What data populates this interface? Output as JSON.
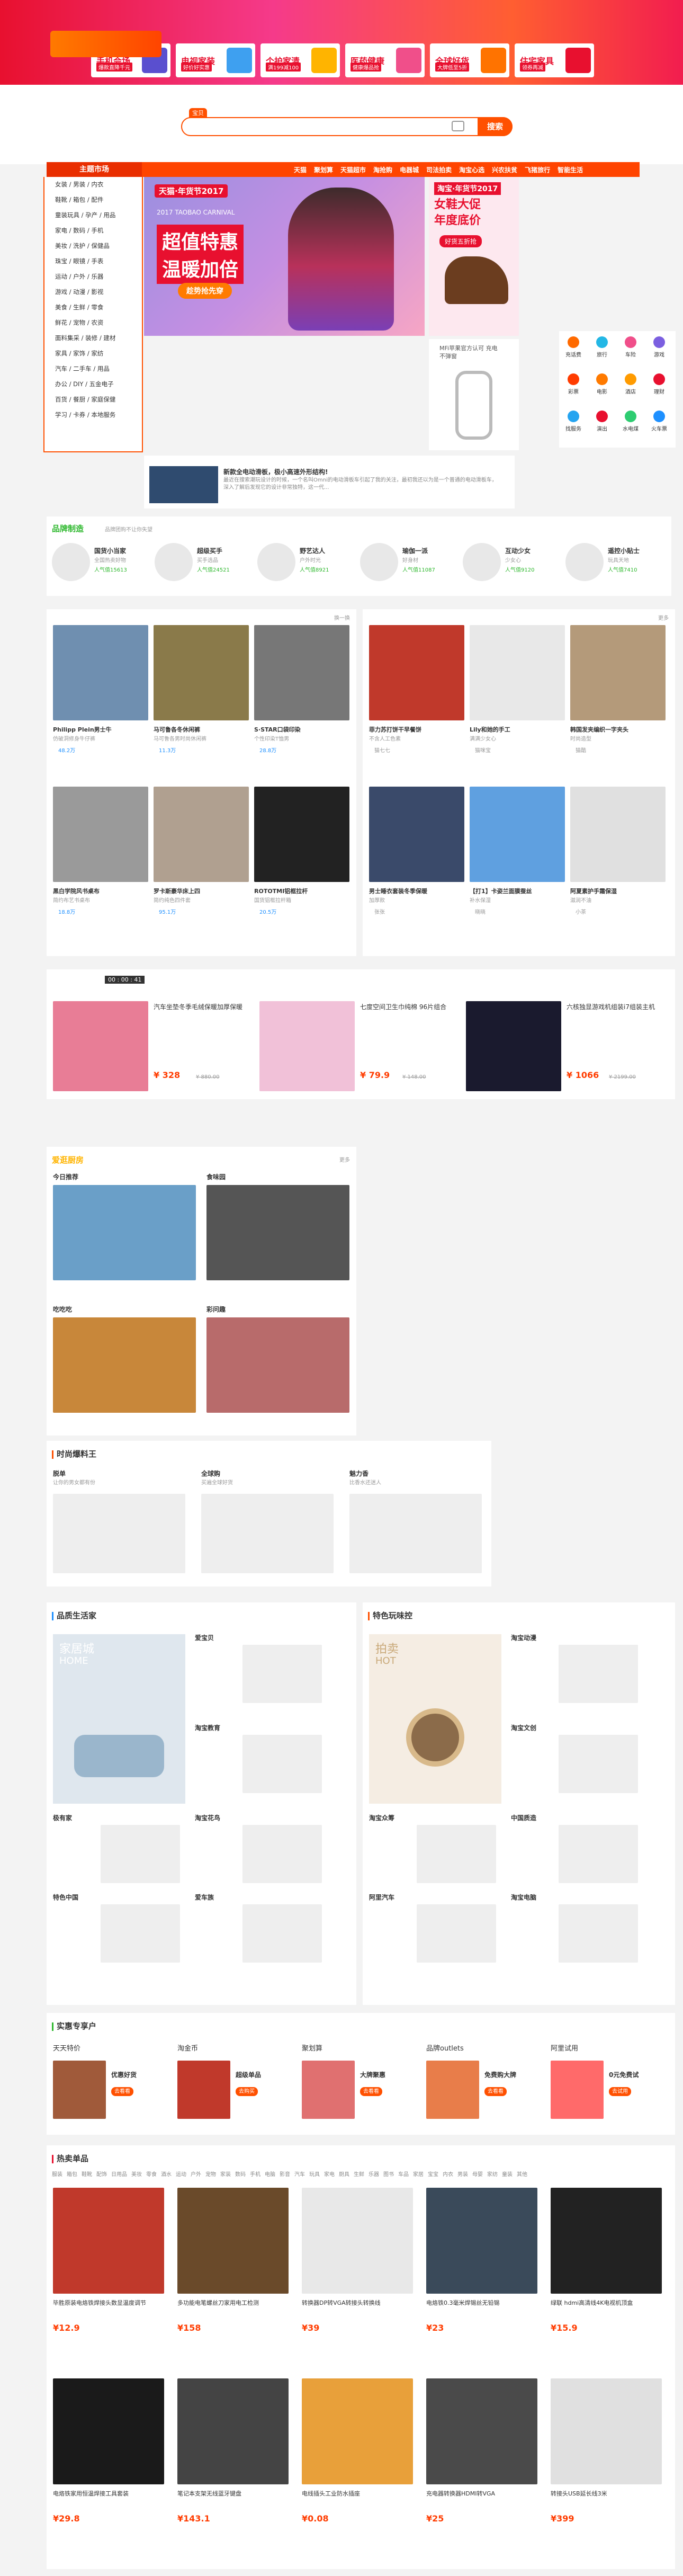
{
  "top_banner": {
    "promos": [
      {
        "title": "手机会场",
        "sub": "爆款直降千元",
        "color": "#5a4fcf"
      },
      {
        "title": "电视家装",
        "sub": "好价好实惠",
        "color": "#3ea0f0"
      },
      {
        "title": "个护家清",
        "sub": "满199减100",
        "color": "#ffb400"
      },
      {
        "title": "医药健康",
        "sub": "健康爆品抢",
        "color": "#f04f8a"
      },
      {
        "title": "全球好货",
        "sub": "大牌低至5折",
        "color": "#ff7300"
      },
      {
        "title": "住宅家具",
        "sub": "领券再减",
        "color": "#e8102f"
      }
    ]
  },
  "search": {
    "tab": "宝贝",
    "placeholder": "",
    "button": "搜索"
  },
  "nav": {
    "title": "主题市场",
    "links": [
      "天猫",
      "聚划算",
      "天猫超市",
      "淘抢购",
      "电器城",
      "司法拍卖",
      "淘宝心选",
      "兴农扶贫",
      "飞猪旅行",
      "智能生活"
    ]
  },
  "categories": [
    "女装 / 男装 / 内衣",
    "鞋靴 / 箱包 / 配件",
    "童装玩具 / 孕产 / 用品",
    "家电 / 数码 / 手机",
    "美妆 / 洗护 / 保健品",
    "珠宝 / 眼镜 / 手表",
    "运动 / 户外 / 乐器",
    "游戏 / 动漫 / 影视",
    "美食 / 生鲜 / 零食",
    "鲜花 / 宠物 / 农资",
    "面料集采 / 装修 / 建材",
    "家具 / 家饰 / 家纺",
    "汽车 / 二手车 / 用品",
    "办公 / DIY / 五金电子",
    "百货 / 餐厨 / 家庭保健",
    "学习 / 卡券 / 本地服务"
  ],
  "carousel": {
    "tag": "天猫·年货节2017",
    "line1": "超值特惠",
    "line2": "温暖加倍",
    "btn": "趁势抢先穿",
    "caption": "2017 TAOBAO CARNIVAL"
  },
  "side_promo": {
    "tag": "淘宝·年货节2017",
    "line1": "女鞋大促",
    "line2": "年度底价",
    "btn": "好货五折抢"
  },
  "cable_ad": {
    "text": "MFi苹果官方认可 充电不弹窗"
  },
  "services": [
    {
      "label": "充话费",
      "color": "#ff6a00"
    },
    {
      "label": "旅行",
      "color": "#23b7e5"
    },
    {
      "label": "车险",
      "color": "#f04f8a"
    },
    {
      "label": "游戏",
      "color": "#7b5fe0"
    },
    {
      "label": "彩票",
      "color": "#ff3c00"
    },
    {
      "label": "电影",
      "color": "#ff7a00"
    },
    {
      "label": "酒店",
      "color": "#ff9b00"
    },
    {
      "label": "理财",
      "color": "#e8102f"
    },
    {
      "label": "找服务",
      "color": "#25a4f0"
    },
    {
      "label": "演出",
      "color": "#e8102f"
    },
    {
      "label": "水电煤",
      "color": "#2ecc71"
    },
    {
      "label": "火车票",
      "color": "#1e90ff"
    }
  ],
  "news": {
    "title": "新款全电动滑板，极小高速外形结构!",
    "body": "最近在搜索潮玩设计的时候，一个名叫Omni的电动滑板车引起了我的关注，最初我还以为是一个普通的电动滑板车，深入了解后发现它的设计非常独特，这一代..."
  },
  "brands": {
    "title": "品牌制造",
    "sub": "品牌团购不让你失望",
    "items": [
      {
        "name": "国货小当家",
        "desc": "全国热卖好物",
        "count": "人气值15613"
      },
      {
        "name": "超级买手",
        "desc": "买手选品",
        "count": "人气值24521"
      },
      {
        "name": "野艺达人",
        "desc": "户外时光",
        "count": "人气值8921"
      },
      {
        "name": "瑜伽一派",
        "desc": "好身材",
        "count": "人气值11087"
      },
      {
        "name": "互动少女",
        "desc": "少女心",
        "count": "人气值9120"
      },
      {
        "name": "遥控小贴士",
        "desc": "玩具天地",
        "count": "人气值7410"
      }
    ]
  },
  "goods_left": {
    "more": "换一换",
    "items": [
      {
        "title": "Philipp Plein男士牛",
        "desc": "仿破洞修身牛仔裤",
        "hearts": "48.2万",
        "color": "#6f8fb0"
      },
      {
        "title": "马可鲁各冬休闲裤",
        "desc": "马可鲁各男时尚休闲裤",
        "hearts": "11.3万",
        "color": "#8a7a4a"
      },
      {
        "title": "S·STAR口袋印染",
        "desc": "个性印染T恤男",
        "hearts": "28.8万",
        "color": "#777"
      },
      {
        "title": "黑白学院风书桌布",
        "desc": "简约布艺书桌布",
        "hearts": "18.8万",
        "color": "#9a9a9a"
      },
      {
        "title": "罗卡斯豪华床上四",
        "desc": "简约纯色四件套",
        "hearts": "95.1万",
        "color": "#b0a090"
      },
      {
        "title": "ROTOTMI铝框拉杆",
        "desc": "国货铝框拉杆箱",
        "hearts": "20.5万",
        "color": "#222"
      }
    ]
  },
  "goods_right": {
    "more": "更多",
    "items": [
      {
        "title": "菲力苏打饼干早餐饼",
        "desc": "不含人工色素",
        "author": "猫七七",
        "color": "#c0392b"
      },
      {
        "title": "Lily和她的手工",
        "desc": "满满少女心",
        "author": "猫咪宝",
        "color": "#e8e8e8"
      },
      {
        "title": "韩国发夹编织一字夹头",
        "desc": "时尚造型",
        "author": "猫酷",
        "color": "#b49a7a"
      },
      {
        "title": "男士睡衣套装冬季保暖",
        "desc": "加厚款",
        "author": "张张",
        "color": "#3a4a6a"
      },
      {
        "title": "【打1】卡姿兰面膜蚕丝",
        "desc": "补水保湿",
        "author": "晓晓",
        "color": "#5fa0e0"
      },
      {
        "title": "阿夏素护手霜保湿",
        "desc": "滋润不油",
        "author": "小茶",
        "color": "#e0e0e0"
      }
    ]
  },
  "flash": {
    "time": "00 : 00 : 41",
    "items": [
      {
        "title": "汽车坐垫冬季毛绒保暖加厚保暖",
        "price": "¥ 328",
        "old": "¥ 880.00",
        "color": "#e87d96"
      },
      {
        "title": "七度空间卫生巾纯棉 96片组合",
        "price": "¥ 79.9",
        "old": "¥ 148.00",
        "color": "#f1c1d8"
      },
      {
        "title": "六核独显游戏机组装i7组装主机",
        "price": "¥ 1066",
        "old": "¥ 2199.00",
        "color": "#1a1a2e"
      }
    ]
  },
  "kitchen": {
    "title": "爱逛厨房",
    "sub": "",
    "more": "更多",
    "items": [
      {
        "label": "今日推荐",
        "color": "#6a9fc8"
      },
      {
        "label": "食味园",
        "color": "#555"
      },
      {
        "label": "吃吃吃",
        "color": "#c8873a"
      },
      {
        "label": "彩问趣",
        "color": "#b86b6b"
      }
    ]
  },
  "fashion": {
    "title": "时尚爆料王",
    "items": [
      {
        "label": "脱单",
        "sub": "让你的男女都有份"
      },
      {
        "label": "全球购",
        "sub": "买遍全球好货"
      },
      {
        "label": "魅力香",
        "sub": "比香水还迷人"
      }
    ]
  },
  "quality": {
    "title": "品质生活家",
    "items": [
      "家居城",
      "爱宝贝",
      "淘宝教育",
      "极有家",
      "淘宝花鸟",
      "特色中国",
      "爱车族"
    ],
    "home_tag": "HOME"
  },
  "special": {
    "title": "特色玩味控",
    "items": [
      "拍卖",
      "淘宝动漫",
      "淘宝文创",
      "淘宝众筹",
      "中国质造",
      "阿里汽车",
      "淘宝电脑"
    ],
    "hot_tag": "HOT"
  },
  "vip": {
    "title": "实惠专享户",
    "items": [
      {
        "name": "天天特价",
        "desc": "优惠好货",
        "tag": "去看看",
        "color": "#a05a3a"
      },
      {
        "name": "淘金币",
        "desc": "超级单品",
        "tag": "去购买",
        "color": "#c0392b"
      },
      {
        "name": "聚划算",
        "desc": "大牌聚惠",
        "tag": "去看看",
        "color": "#e07070"
      },
      {
        "name": "品牌outlets",
        "desc": "免费购大牌",
        "tag": "去看看",
        "color": "#e87d4a"
      },
      {
        "name": "阿里试用",
        "desc": "0元免费试",
        "tag": "去试用",
        "color": "#ff6a6a"
      }
    ]
  },
  "hot": {
    "title": "热卖单品",
    "tabs": [
      "服装",
      "箱包",
      "鞋靴",
      "配饰",
      "日用品",
      "美妆",
      "零食",
      "酒水",
      "运动",
      "户外",
      "宠物",
      "家装",
      "数码",
      "手机",
      "电脑",
      "影音",
      "汽车",
      "玩具",
      "家电",
      "厨具",
      "生鲜",
      "乐器",
      "图书",
      "车品",
      "家居",
      "宝宝",
      "内衣",
      "男装",
      "母婴",
      "家纺",
      "童装",
      "其他"
    ],
    "row1": [
      {
        "title": "毕胜原装电烙铁焊接头数显温度调节",
        "price": "¥12.9",
        "color": "#c0392b"
      },
      {
        "title": "多功能电笔螺丝刀家用电工检测",
        "price": "¥158",
        "color": "#6a4a2a"
      },
      {
        "title": "转换器DP转VGA转接头转换线",
        "price": "¥39",
        "color": "#e8e8e8"
      },
      {
        "title": "电烙铁0.3毫米焊锡丝无铅锡",
        "price": "¥23",
        "color": "#3a4a5a"
      },
      {
        "title": "绿联 hdmi高清线4K电视机顶盒",
        "price": "¥15.9",
        "color": "#222"
      }
    ],
    "row2": [
      {
        "title": "电烙铁家用恒温焊接工具套装",
        "price": "¥29.8",
        "color": "#1a1a1a"
      },
      {
        "title": "笔记本支架无线蓝牙键盘",
        "price": "¥143.1",
        "color": "#444"
      },
      {
        "title": "电线插头工业防水插座",
        "price": "¥0.08",
        "color": "#e8a03a"
      },
      {
        "title": "充电器转换器HDMI转VGA",
        "price": "¥25",
        "color": "#4a4a4a"
      },
      {
        "title": "转接头USB延长线3米",
        "price": "¥399",
        "color": "#e0e0e0"
      }
    ]
  }
}
